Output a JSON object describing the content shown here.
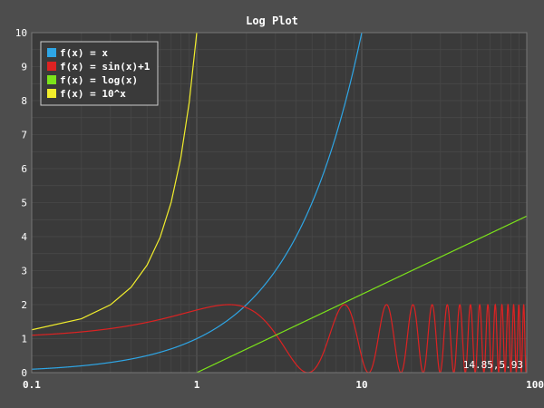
{
  "window": {
    "title": "Log Plot"
  },
  "readout": "14.85,5.93",
  "colors": {
    "background": "#4d4d4d",
    "plot_background": "#3a3a3a",
    "grid_minor": "#4a4a4a",
    "grid_major": "#5c5c5c",
    "text": "#ffffff"
  },
  "chart_data": {
    "type": "line",
    "title": "Log Plot",
    "x_scale": "log",
    "xlim": [
      0.1,
      100
    ],
    "ylim": [
      0,
      10
    ],
    "x_ticks": [
      "0.1",
      "1",
      "10",
      "100"
    ],
    "y_ticks": [
      "0",
      "1",
      "2",
      "3",
      "4",
      "5",
      "6",
      "7",
      "8",
      "9",
      "10"
    ],
    "grid": true,
    "legend_position": "top-left",
    "series": [
      {
        "name": "f(x) = x",
        "color": "#2ea6e6",
        "formula": "x"
      },
      {
        "name": "f(x) = sin(x)+1",
        "color": "#dd2222",
        "formula": "sin(x)+1"
      },
      {
        "name": "f(x) = log(x)",
        "color": "#7ce41a",
        "formula": "log(x)"
      },
      {
        "name": "f(x) = 10^x",
        "color": "#f2ee2c",
        "formula": "10^x"
      }
    ]
  }
}
